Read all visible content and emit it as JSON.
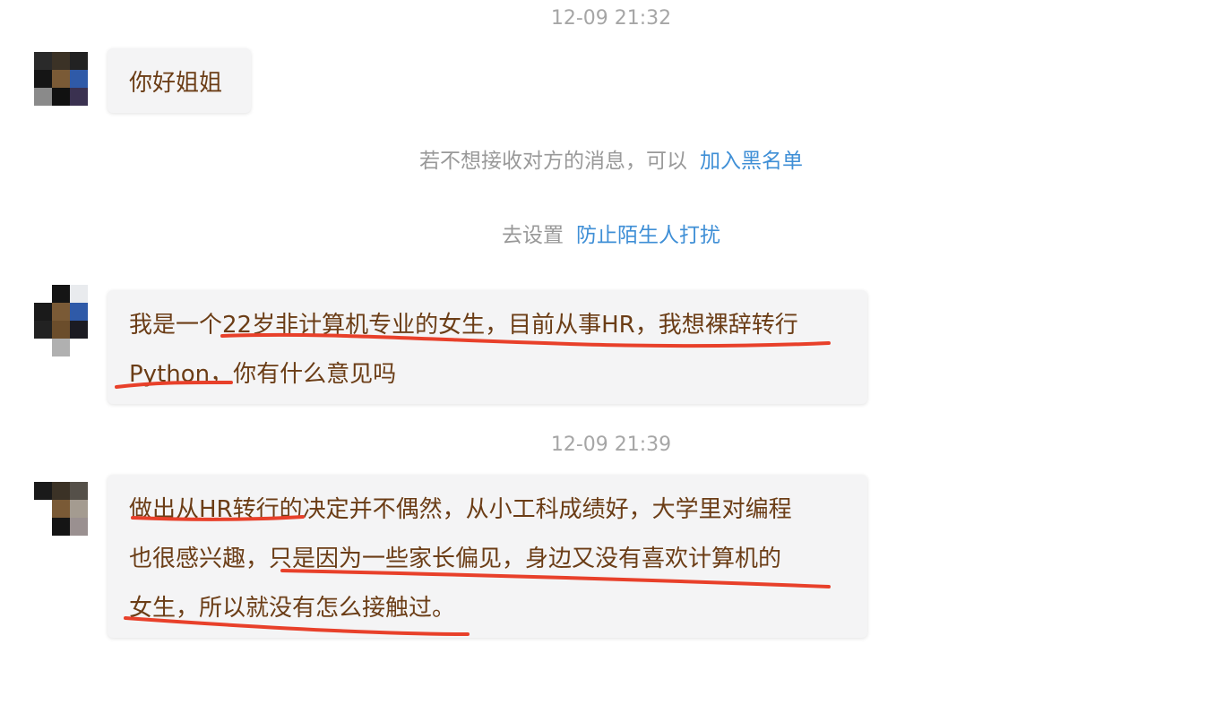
{
  "timestamps": [
    "12-09 21:32",
    "12-09 21:39"
  ],
  "messages": [
    {
      "lines": [
        "你好姐姐"
      ]
    },
    {
      "lines": [
        "我是一个22岁非计算机专业的女生，目前从事HR，我想裸辞转行",
        "Python，你有什么意见吗"
      ]
    },
    {
      "lines": [
        "做出从HR转行的决定并不偶然，从小工科成绩好，大学里对编程",
        "也很感兴趣，只是因为一些家长偏见，身边又没有喜欢计算机的",
        "女生，所以就没有怎么接触过。"
      ]
    }
  ],
  "system_notices": {
    "block": {
      "text": "若不想接收对方的消息，可以",
      "link": "加入黑名单"
    },
    "stranger": {
      "text": "去设置",
      "link": "防止陌生人打扰"
    }
  },
  "colors": {
    "bubble_text": "#6b3d16",
    "link": "#3f8fd6",
    "annotation": "#e8402a",
    "muted": "#999999"
  },
  "icons": [
    "avatar"
  ]
}
